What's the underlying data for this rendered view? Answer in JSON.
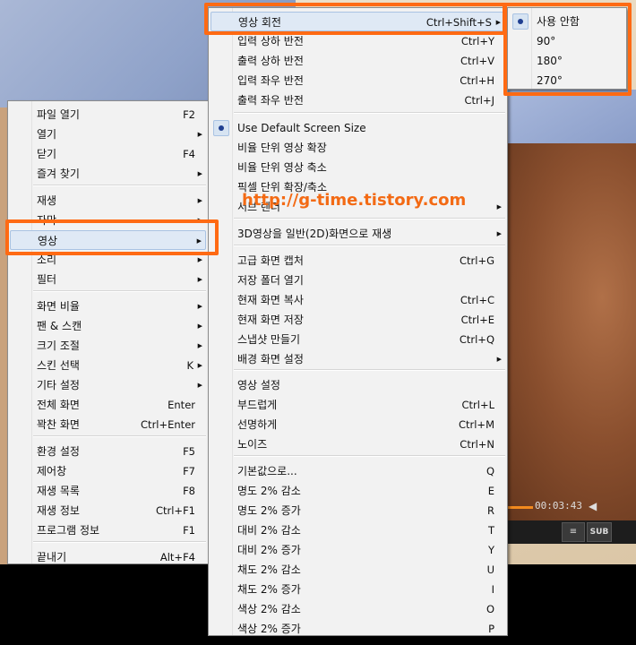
{
  "watermark": "http://g-time.tistory.com",
  "player": {
    "time": "00:03:43",
    "sub_label": "SUB"
  },
  "main_menu": {
    "items": [
      {
        "label": "파일 열기",
        "shortcut": "F2",
        "submenu": false
      },
      {
        "label": "열기",
        "shortcut": "",
        "submenu": true
      },
      {
        "label": "닫기",
        "shortcut": "F4",
        "submenu": false
      },
      {
        "label": "즐겨 찾기",
        "shortcut": "",
        "submenu": true
      },
      {
        "label": "재생",
        "shortcut": "",
        "submenu": true
      },
      {
        "label": "자막",
        "shortcut": "",
        "submenu": true
      },
      {
        "label": "영상",
        "shortcut": "",
        "submenu": true
      },
      {
        "label": "소리",
        "shortcut": "",
        "submenu": true
      },
      {
        "label": "필터",
        "shortcut": "",
        "submenu": true
      },
      {
        "label": "화면 비율",
        "shortcut": "",
        "submenu": true
      },
      {
        "label": "팬 & 스캔",
        "shortcut": "",
        "submenu": true
      },
      {
        "label": "크기 조절",
        "shortcut": "",
        "submenu": true
      },
      {
        "label": "스킨 선택",
        "shortcut": "K",
        "submenu": true
      },
      {
        "label": "기타 설정",
        "shortcut": "",
        "submenu": true
      },
      {
        "label": "전체 화면",
        "shortcut": "Enter",
        "submenu": false
      },
      {
        "label": "꽉찬 화면",
        "shortcut": "Ctrl+Enter",
        "submenu": false
      },
      {
        "label": "환경 설정",
        "shortcut": "F5",
        "submenu": false
      },
      {
        "label": "제어창",
        "shortcut": "F7",
        "submenu": false
      },
      {
        "label": "재생 목록",
        "shortcut": "F8",
        "submenu": false
      },
      {
        "label": "재생 정보",
        "shortcut": "Ctrl+F1",
        "submenu": false
      },
      {
        "label": "프로그램 정보",
        "shortcut": "F1",
        "submenu": false
      },
      {
        "label": "끝내기",
        "shortcut": "Alt+F4",
        "submenu": false
      }
    ]
  },
  "video_menu": {
    "items": [
      {
        "label": "영상 회전",
        "shortcut": "Ctrl+Shift+S",
        "submenu": true
      },
      {
        "label": "입력 상하 반전",
        "shortcut": "Ctrl+Y",
        "submenu": false
      },
      {
        "label": "출력 상하 반전",
        "shortcut": "Ctrl+V",
        "submenu": false
      },
      {
        "label": "입력 좌우 반전",
        "shortcut": "Ctrl+H",
        "submenu": false
      },
      {
        "label": "출력 좌우 반전",
        "shortcut": "Ctrl+J",
        "submenu": false
      },
      {
        "label": "Use Default Screen Size",
        "shortcut": "",
        "submenu": false
      },
      {
        "label": "비율 단위 영상 확장",
        "shortcut": "",
        "submenu": false
      },
      {
        "label": "비율 단위 영상 축소",
        "shortcut": "",
        "submenu": false
      },
      {
        "label": "픽셀 단위 확장/축소",
        "shortcut": "",
        "submenu": false
      },
      {
        "label": "서브 렌더",
        "shortcut": "",
        "submenu": true
      },
      {
        "label": "3D영상을 일반(2D)화면으로 재생",
        "shortcut": "",
        "submenu": true
      },
      {
        "label": "고급 화면 캡처",
        "shortcut": "Ctrl+G",
        "submenu": false
      },
      {
        "label": "저장 폴더 열기",
        "shortcut": "",
        "submenu": false
      },
      {
        "label": "현재 화면 복사",
        "shortcut": "Ctrl+C",
        "submenu": false
      },
      {
        "label": "현재 화면 저장",
        "shortcut": "Ctrl+E",
        "submenu": false
      },
      {
        "label": "스냅샷 만들기",
        "shortcut": "Ctrl+Q",
        "submenu": false
      },
      {
        "label": "배경 화면 설정",
        "shortcut": "",
        "submenu": true
      },
      {
        "label": "영상 설정",
        "shortcut": "",
        "submenu": false
      },
      {
        "label": "부드럽게",
        "shortcut": "Ctrl+L",
        "submenu": false
      },
      {
        "label": "선명하게",
        "shortcut": "Ctrl+M",
        "submenu": false
      },
      {
        "label": "노이즈",
        "shortcut": "Ctrl+N",
        "submenu": false
      },
      {
        "label": "기본값으로...",
        "shortcut": "Q",
        "submenu": false
      },
      {
        "label": "명도    2% 감소",
        "shortcut": "E",
        "submenu": false
      },
      {
        "label": "명도    2% 증가",
        "shortcut": "R",
        "submenu": false
      },
      {
        "label": "대비    2% 감소",
        "shortcut": "T",
        "submenu": false
      },
      {
        "label": "대비    2% 증가",
        "shortcut": "Y",
        "submenu": false
      },
      {
        "label": "채도    2% 감소",
        "shortcut": "U",
        "submenu": false
      },
      {
        "label": "채도    2% 증가",
        "shortcut": "I",
        "submenu": false
      },
      {
        "label": "색상    2% 감소",
        "shortcut": "O",
        "submenu": false
      },
      {
        "label": "색상    2% 증가",
        "shortcut": "P",
        "submenu": false
      }
    ]
  },
  "rotate_menu": {
    "items": [
      {
        "label": "사용 안함",
        "checked": true
      },
      {
        "label": "90°",
        "checked": false
      },
      {
        "label": "180°",
        "checked": false
      },
      {
        "label": "270°",
        "checked": false
      }
    ]
  },
  "colors": {
    "highlight": "#ff6a13",
    "watermark": "#f36a14",
    "menu_bg": "#f2f2f2"
  }
}
